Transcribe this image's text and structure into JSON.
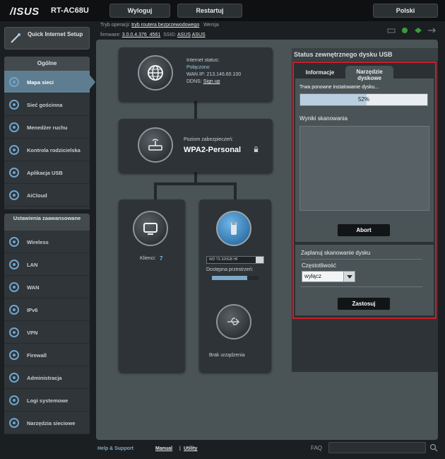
{
  "header": {
    "logo": "/ISUS",
    "model": "RT-AC68U",
    "logout_label": "Wyloguj",
    "restart_label": "Restartuj",
    "language": "Polski",
    "mode_label": "Tryb operacji:",
    "mode_value": "tryb routera bezprzewodowego",
    "version_label": "Wersja",
    "firmware_label": "firmware:",
    "firmware_value": "3.0.0.4.376_4561",
    "ssid_label": "SSID:",
    "ssid_1": "ASUS",
    "ssid_2": "ASUS"
  },
  "sidebar": {
    "quick_setup": "Quick Internet Setup",
    "general_header": "Ogólne",
    "general_items": [
      {
        "label": "Mapa sieci",
        "icon": "network-map-icon",
        "active": true
      },
      {
        "label": "Sieć gościnna",
        "icon": "guest-network-icon",
        "active": false
      },
      {
        "label": "Menedżer ruchu",
        "icon": "traffic-manager-icon",
        "active": false
      },
      {
        "label": "Kontrola rodzicielska",
        "icon": "parental-control-icon",
        "active": false
      },
      {
        "label": "Aplikacja USB",
        "icon": "usb-app-icon",
        "active": false
      },
      {
        "label": "AiCloud",
        "icon": "cloud-icon",
        "active": false
      }
    ],
    "advanced_header": "Ustawienia zaawansowane",
    "advanced_items": [
      {
        "label": "Wireless",
        "icon": "wireless-icon"
      },
      {
        "label": "LAN",
        "icon": "lan-icon"
      },
      {
        "label": "WAN",
        "icon": "wan-icon"
      },
      {
        "label": "IPv6",
        "icon": "ipv6-icon"
      },
      {
        "label": "VPN",
        "icon": "vpn-icon"
      },
      {
        "label": "Firewall",
        "icon": "firewall-icon"
      },
      {
        "label": "Administracja",
        "icon": "admin-icon"
      },
      {
        "label": "Logi systemowe",
        "icon": "system-log-icon"
      },
      {
        "label": "Narzędzia sieciowe",
        "icon": "network-tools-icon"
      }
    ]
  },
  "map": {
    "internet_status_label": "Internet status:",
    "internet_status_value": "Połączono",
    "wan_ip_label": "WAN IP:",
    "wan_ip_value": "213.146.60.100",
    "ddns_label": "DDNS:",
    "ddns_link": "Sign up",
    "security_label": "Poziom zabezpieczeń:",
    "security_value": "WPA2-Personal",
    "clients_label": "Klienci:",
    "clients_count": "7",
    "usb_device": "WD TS 320GB HF",
    "usb_available_label": "Dostępna przestrzeń:",
    "usb_available_fraction": 0.75,
    "no_device_label": "Brak urządzenia"
  },
  "usb_panel": {
    "title": "Status zewnętrznego dysku USB",
    "tab_info": "Informacje",
    "tab_tool": "Narzędzie dyskowe",
    "reinstall_text": "Trwa ponowne instalowanie dysku...",
    "progress_percent": 52,
    "progress_label": "52%",
    "scan_results_label": "Wyniki skanowania",
    "abort_label": "Abort",
    "schedule_title": "Zaplanuj skanowanie dysku",
    "frequency_label": "Częstotliwość",
    "frequency_value": "wyłącz",
    "apply_label": "Zastosuj"
  },
  "footer": {
    "help_label": "Help & Support",
    "manual_label": "Manual",
    "separator": "|",
    "utility_label": "Utility",
    "faq_label": "FAQ"
  },
  "colors": {
    "accent": "#5f7d90",
    "highlight_border": "#cc1f2a",
    "progress_fill": "#b9cfe0"
  }
}
